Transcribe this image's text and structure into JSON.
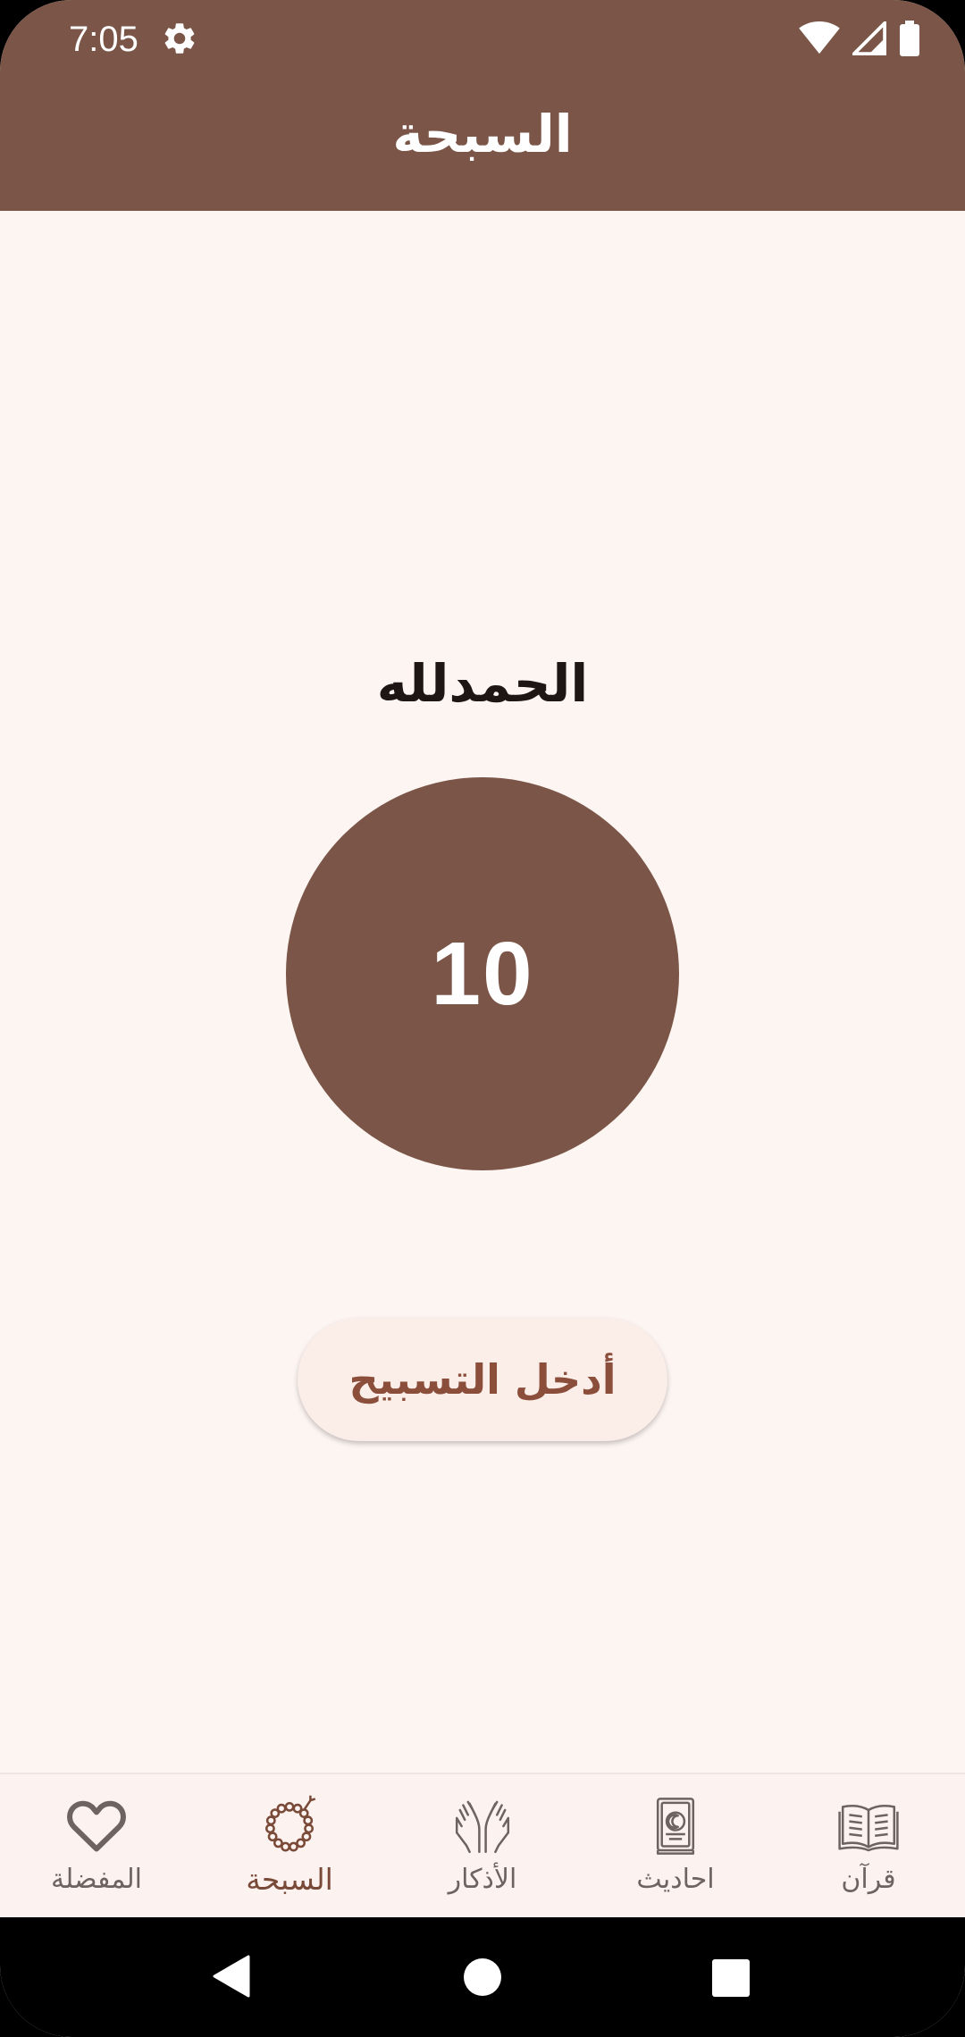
{
  "status_bar": {
    "time": "7:05",
    "icons": [
      "gear-icon",
      "wifi-icon",
      "signal-icon",
      "battery-icon"
    ]
  },
  "app_bar": {
    "title": "السبحة"
  },
  "main": {
    "dhikr": "الحمدلله",
    "count": "10",
    "enter_button_label": "أدخل التسبيح"
  },
  "bottom_nav": {
    "items": [
      {
        "label": "المفضلة",
        "icon": "heart-icon",
        "active": false
      },
      {
        "label": "السبحة",
        "icon": "prayer-beads-icon",
        "active": true
      },
      {
        "label": "الأذكار",
        "icon": "praying-hands-icon",
        "active": false
      },
      {
        "label": "احاديث",
        "icon": "hadith-book-icon",
        "active": false
      },
      {
        "label": "قرآن",
        "icon": "open-quran-icon",
        "active": false
      }
    ]
  },
  "colors": {
    "primary": "#7A5548",
    "background": "#FDF5F2",
    "button_bg": "#FBEDE8",
    "button_text": "#8A4E3A",
    "active_nav": "#7A4A38"
  }
}
